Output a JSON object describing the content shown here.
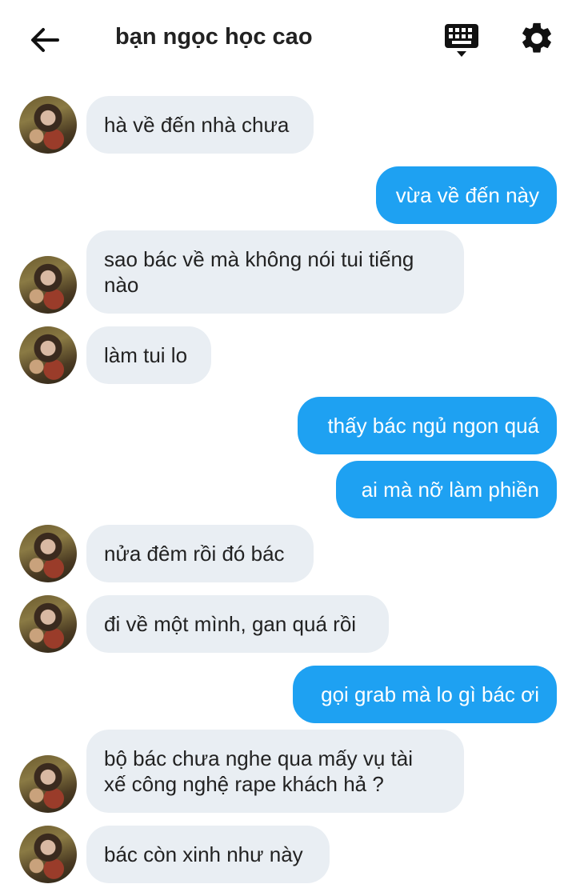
{
  "header": {
    "title": "bạn ngọc học cao",
    "icons": [
      "arrow-left-icon",
      "keyboard-icon",
      "gear-icon"
    ]
  },
  "messages": [
    {
      "side": "in",
      "text": "hà về đến nhà chưa",
      "avatar": true
    },
    {
      "side": "out",
      "text": "vừa về đến này"
    },
    {
      "side": "in",
      "text": "sao bác về mà không nói tui tiếng\nnào",
      "avatar": true
    },
    {
      "side": "in",
      "text": "làm tui lo",
      "avatar": true
    },
    {
      "side": "out",
      "text": "thấy bác ngủ ngon quá"
    },
    {
      "side": "out",
      "text": "ai mà nỡ làm phiền"
    },
    {
      "side": "in",
      "text": "nửa đêm rồi đó bác",
      "avatar": true
    },
    {
      "side": "in",
      "text": "đi về một mình, gan quá rồi",
      "avatar": true
    },
    {
      "side": "out",
      "text": "gọi grab mà lo gì bác ơi"
    },
    {
      "side": "in",
      "text": "bộ bác chưa nghe qua mấy vụ tài\nxế công nghệ rape khách hả ?",
      "avatar": true
    },
    {
      "side": "in",
      "text": "bác còn xinh như này",
      "avatar": true
    }
  ],
  "colors": {
    "incoming_bubble": "#e9eef3",
    "outgoing_bubble": "#1ea1f2"
  }
}
